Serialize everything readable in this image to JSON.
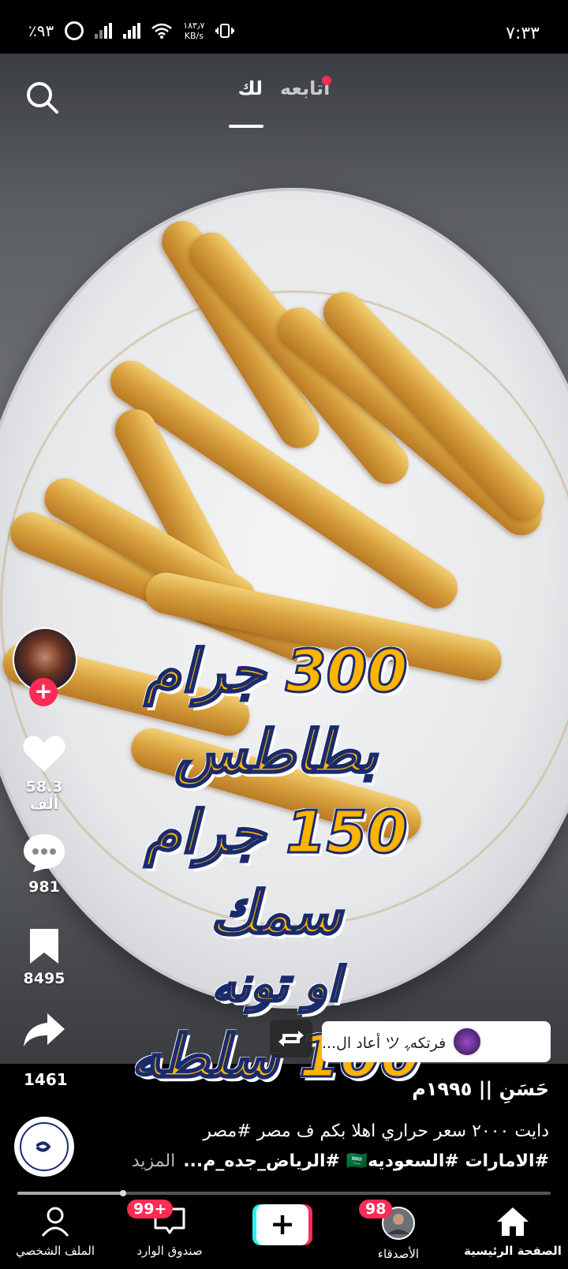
{
  "status_bar": {
    "time": "٧:٣٣",
    "battery": "٪٩٣",
    "net_speed_value": "١٨٣٫٧",
    "net_speed_unit": "KB/s"
  },
  "top_nav": {
    "tab_following": "أتابعه",
    "tab_for_you": "لك",
    "search_icon": "search-icon"
  },
  "video_overlay": {
    "line1": "300 جرام بطاطس",
    "line2": "150 جرام سمك",
    "line3": "او تونه",
    "line4": "100 سلطه"
  },
  "actions": {
    "likes": "58.3 ألف",
    "comments": "981",
    "saves": "8495",
    "shares": "1461"
  },
  "repost": {
    "text": "فرتكهﮩ ツ أعاد ال..."
  },
  "caption": {
    "author": "حَسَنِ || ١٩٩٥م",
    "line1": "دايت ٢٠٠٠ سعر حراري اهلا بكم ف مصر #مصر",
    "line2": "#الامارات #السعوديه🇸🇦 #الرياض_جده_م...",
    "more": "المزيد"
  },
  "playback": {
    "progress_fraction": 0.2
  },
  "bottom_nav": {
    "home": "الصفحة الرئيسية",
    "friends": "الأصدقاء",
    "friends_badge": "98",
    "create": "+",
    "inbox": "صندوق الوارد",
    "inbox_badge": "99+",
    "profile": "الملف الشخصي"
  },
  "colors": {
    "accent": "#fe2c55",
    "cyan": "#25f4ee",
    "overlay_text": "#ffb400"
  }
}
